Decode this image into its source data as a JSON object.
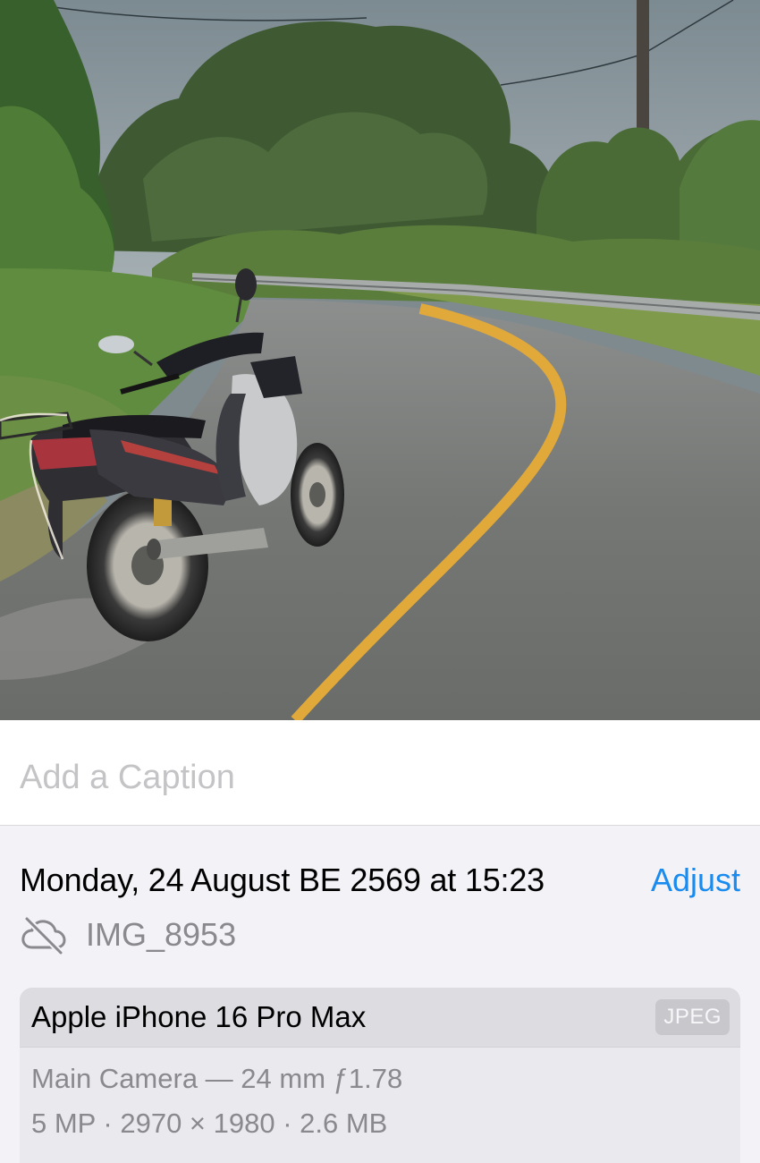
{
  "caption": {
    "placeholder": "Add a Caption"
  },
  "info": {
    "datetime": "Monday, 24 August BE 2569 at 15:23",
    "adjust_label": "Adjust",
    "filename": "IMG_8953",
    "cloud_icon": "cloud-slash-icon"
  },
  "device": {
    "name": "Apple iPhone 16 Pro Max",
    "format": "JPEG",
    "lens": "Main Camera — 24 mm ƒ1.78",
    "specs": "5 MP · 2970 × 1980 · 2.6 MB"
  },
  "colors": {
    "accent": "#1a8cf0",
    "secondary_text": "#8a8a8e",
    "background": "#f2f2f7"
  }
}
